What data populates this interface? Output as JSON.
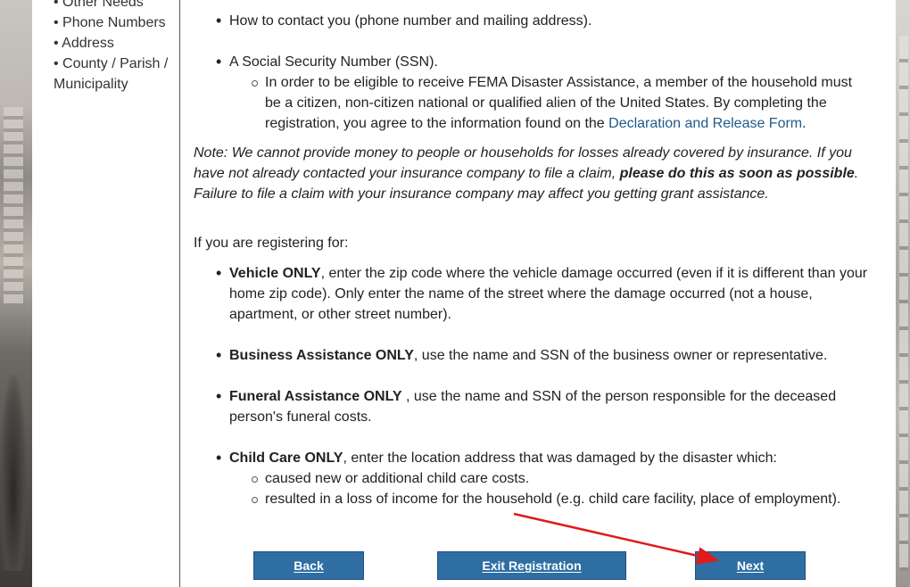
{
  "sidebar": {
    "items": [
      "• Other Needs",
      "• Phone Numbers",
      "• Address",
      "• County / Parish / Municipality"
    ]
  },
  "content": {
    "bullet_contact": "How to contact you (phone number and mailing address).",
    "bullet_ssn": "A Social Security Number (SSN).",
    "ssn_sub_text": "In order to be eligible to receive FEMA Disaster Assistance, a member of the household must be a citizen, non-citizen national or qualified alien of the United States. By completing the registration, you agree to the information found on the ",
    "ssn_sub_link": "Declaration and Release Form",
    "ssn_sub_end": ".",
    "note_part1": "Note: We cannot provide money to people or households for losses already covered by insurance. If you have not already contacted your insurance company to file a claim, ",
    "note_bold": "please do this as soon as possible",
    "note_part2": ". Failure to file a claim with your insurance company may affect you getting grant assistance.",
    "registering_intro": "If you are registering for:",
    "vehicle_bold": "Vehicle ONLY",
    "vehicle_text": ", enter the zip code where the vehicle damage occurred (even if it is different than your home zip code). Only enter the name of the street where the damage occurred (not a house, apartment, or other street number).",
    "business_bold": "Business Assistance ONLY",
    "business_text": ", use the name and SSN of the business owner or representative.",
    "funeral_bold": "Funeral Assistance ONLY",
    "funeral_text": " , use the name and SSN of the person responsible for the deceased person's funeral costs.",
    "childcare_bold": "Child Care ONLY",
    "childcare_text": ", enter the location address that was damaged by the disaster which:",
    "childcare_sub1": "caused new or additional child care costs.",
    "childcare_sub2": "resulted in a loss of income for the household (e.g. child care facility, place of employment)."
  },
  "buttons": {
    "back": "Back",
    "exit": "Exit Registration",
    "next": "Next"
  },
  "colors": {
    "button_bg": "#2f6ea3",
    "link": "#1f5a8a",
    "annotation_arrow": "#e01b1b"
  }
}
